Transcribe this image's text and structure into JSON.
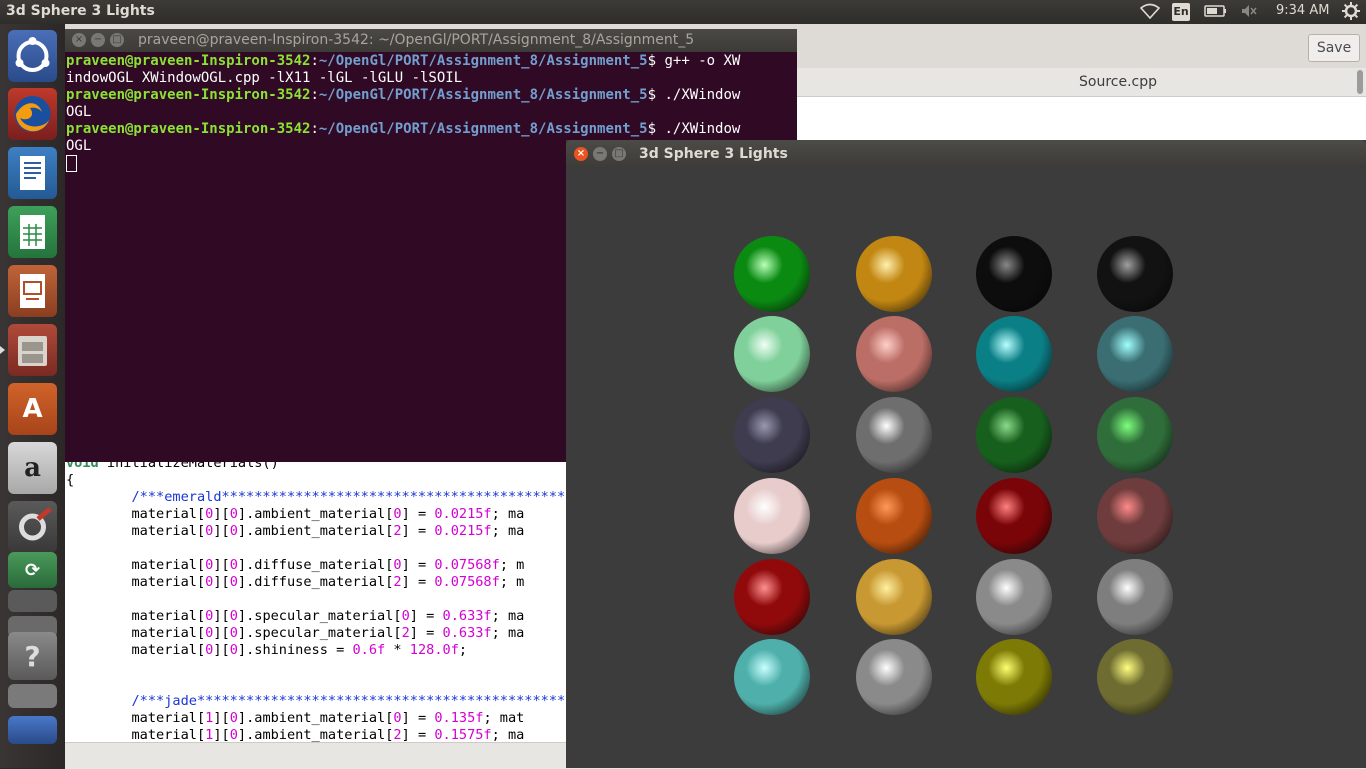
{
  "top_panel": {
    "title": "3d Sphere 3 Lights",
    "lang": "En",
    "time": "9:34 AM"
  },
  "launcher": {
    "items": [
      "ubuntu-dash-icon",
      "firefox-icon",
      "libreoffice-writer-icon",
      "libreoffice-calc-icon",
      "libreoffice-impress-icon",
      "files-icon",
      "software-center-icon",
      "amazon-icon",
      "system-settings-icon",
      "software-updater-icon",
      "image-viewer-icon",
      "disk-icon",
      "help-icon",
      "workspace-switcher-icon",
      "trash-icon"
    ]
  },
  "editor": {
    "save_label": "Save",
    "tab_title": "Source.cpp",
    "tab_close": "×",
    "code_lines": [
      {
        "t": "void initializeMaterials()"
      },
      {
        "t": "{"
      },
      {
        "t": "        /***emerald******************************************"
      },
      {
        "t": "        material[0][0].ambient_material[0] = 0.0215f; ma"
      },
      {
        "t": "        material[0][0].ambient_material[2] = 0.0215f; ma"
      },
      {
        "t": ""
      },
      {
        "t": "        material[0][0].diffuse_material[0] = 0.07568f; m"
      },
      {
        "t": "        material[0][0].diffuse_material[2] = 0.07568f; m"
      },
      {
        "t": ""
      },
      {
        "t": "        material[0][0].specular_material[0] = 0.633f; ma"
      },
      {
        "t": "        material[0][0].specular_material[2] = 0.633f; ma"
      },
      {
        "t": "        material[0][0].shininess = 0.6f * 128.0f;"
      },
      {
        "t": ""
      },
      {
        "t": ""
      },
      {
        "t": "        /***jade*********************************************"
      },
      {
        "t": "        material[1][0].ambient_material[0] = 0.135f; mat"
      },
      {
        "t": "        material[1][0].ambient_material[2] = 0.1575f; ma"
      }
    ]
  },
  "terminal": {
    "title": "praveen@praveen-Inspiron-3542: ~/OpenGl/PORT/Assignment_8/Assignment_5",
    "user": "praveen@praveen-Inspiron-3542",
    "path": "~/OpenGl/PORT/Assignment_8/Assignment_5",
    "cmd1a": " g++ -o XW",
    "cmd1b": "indowOGL XWindowOGL.cpp -lX11 -lGL -lGLU -lSOIL",
    "cmd2a": " ./XWindow",
    "cmd2b": "OGL",
    "cmd3a": " ./XWindow",
    "cmd3b": "OGL"
  },
  "gl_window": {
    "title": "3d Sphere 3 Lights",
    "spheres": [
      [
        "#0b8a12",
        "#c28712",
        "#0d0d0d",
        "#121212"
      ],
      [
        "#7fd09a",
        "#bb6e66",
        "#0b7f86",
        "#3a6e73"
      ],
      [
        "#3e3c4e",
        "#6e6e6e",
        "#175f1d",
        "#2f6e3a"
      ],
      [
        "#e8cccc",
        "#b74d10",
        "#7a0508",
        "#6e3c3c"
      ],
      [
        "#900a0c",
        "#c89832",
        "#8a8a8a",
        "#7e7e7e"
      ],
      [
        "#4fb0ab",
        "#8a8a8a",
        "#7d7a05",
        "#6e6c30"
      ]
    ],
    "highlights": [
      [
        "#b8ffb8",
        "#fff0b0",
        "#888888",
        "#a0a0a0"
      ],
      [
        "#f0fff4",
        "#ffd0c8",
        "#b8ffff",
        "#a0ffff"
      ],
      [
        "#9a98b0",
        "#ffffff",
        "#8adb8a",
        "#7cff7c"
      ],
      [
        "#ffffff",
        "#ff9a5a",
        "#ff8080",
        "#ff8a8a"
      ],
      [
        "#ff9090",
        "#fff0a0",
        "#ffffff",
        "#ffffff"
      ],
      [
        "#c8ffff",
        "#ffffff",
        "#ffff70",
        "#ffff80"
      ]
    ]
  }
}
